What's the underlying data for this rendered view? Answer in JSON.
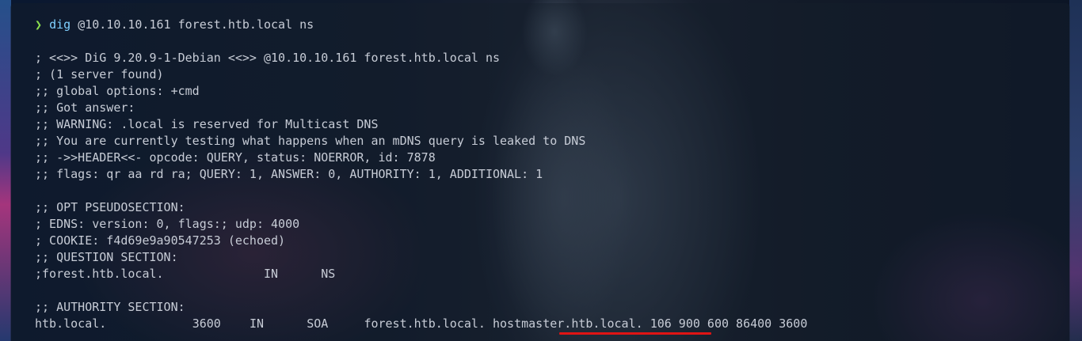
{
  "terminal": {
    "prompt": {
      "symbol": "❯",
      "command": "dig",
      "args": "@10.10.10.161 forest.htb.local ns"
    },
    "header": {
      "banner": "; <<>> DiG 9.20.9-1-Debian <<>> @10.10.10.161 forest.htb.local ns",
      "servers_found": "; (1 server found)",
      "global_options": ";; global options: +cmd",
      "got_answer": ";; Got answer:",
      "warning_1": ";; WARNING: .local is reserved for Multicast DNS",
      "warning_2": ";; You are currently testing what happens when an mDNS query is leaked to DNS",
      "header_line": ";; ->>HEADER<<- opcode: QUERY, status: NOERROR, id: 7878",
      "flags_line": ";; flags: qr aa rd ra; QUERY: 1, ANSWER: 0, AUTHORITY: 1, ADDITIONAL: 1"
    },
    "opt_section": {
      "title": ";; OPT PSEUDOSECTION:",
      "edns": "; EDNS: version: 0, flags:; udp: 4000",
      "cookie": "; COOKIE: f4d69e9a90547253 (echoed)"
    },
    "question_section": {
      "title": ";; QUESTION SECTION:",
      "record": {
        "name": ";forest.htb.local.",
        "class": "IN",
        "type": "NS"
      }
    },
    "authority_section": {
      "title": ";; AUTHORITY SECTION:",
      "record": {
        "name": "htb.local.",
        "ttl": "3600",
        "class": "IN",
        "type": "SOA",
        "mname": "forest.htb.local.",
        "rname": "hostmaster.htb.local.",
        "rest": "106 900 600 86400 3600"
      }
    }
  },
  "colors": {
    "prompt_arrow": "#8be04e",
    "command": "#7fd0ff",
    "output_text": "#c7ccd6",
    "highlight_underline": "#e01414"
  }
}
